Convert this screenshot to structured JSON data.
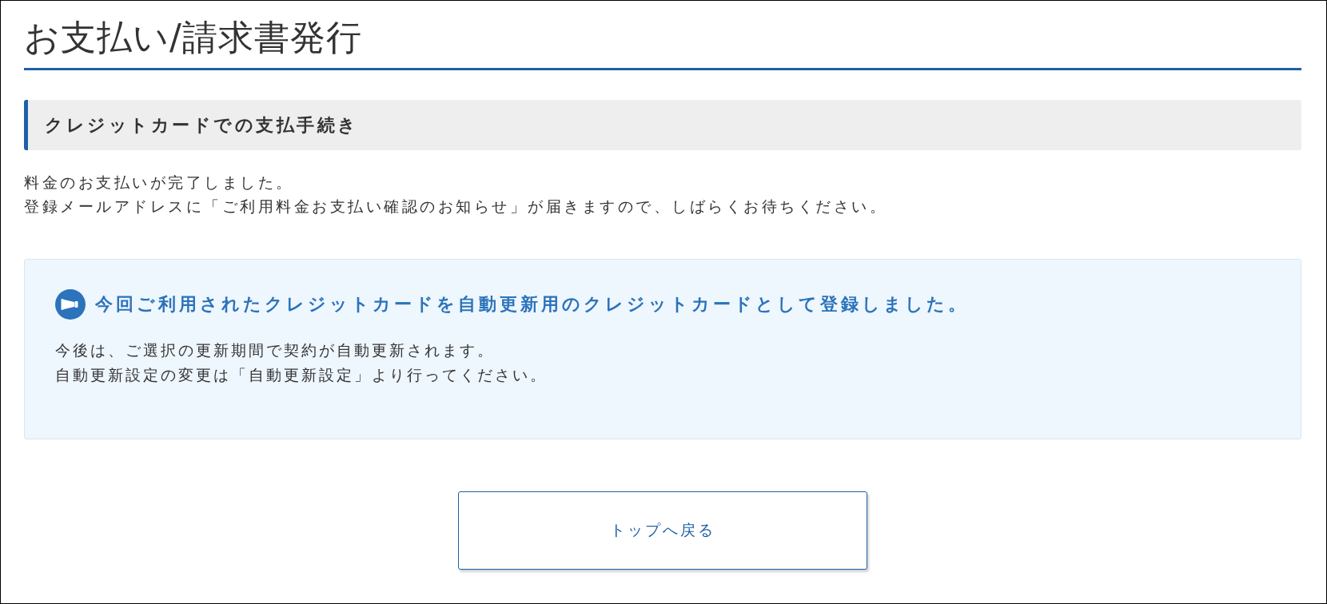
{
  "page": {
    "title": "お支払い/請求書発行"
  },
  "section": {
    "heading": "クレジットカードでの支払手続き"
  },
  "message": [
    "料金のお支払いが完了しました。",
    "登録メールアドレスに「ご利用料金お支払い確認のお知らせ」が届きますので、しばらくお待ちください。"
  ],
  "notice": {
    "heading": "今回ご利用されたクレジットカードを自動更新用のクレジットカードとして登録しました。",
    "body": [
      "今後は、ご選択の更新期間で契約が自動更新されます。",
      "自動更新設定の変更は「自動更新設定」より行ってください。"
    ]
  },
  "buttons": [
    {
      "label": "トップへ戻る"
    }
  ]
}
